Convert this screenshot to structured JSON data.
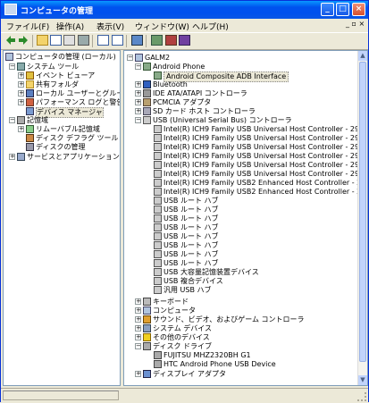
{
  "window": {
    "title": "コンピュータの管理"
  },
  "menu": [
    "ファイル(F)",
    "操作(A)",
    "表示(V)",
    "ウィンドウ(W)",
    "ヘルプ(H)"
  ],
  "left_tree": {
    "root": "コンピュータの管理 (ローカル)",
    "system_tools": "システム ツール",
    "event_viewer": "イベント ビューア",
    "shared_folders": "共有フォルダ",
    "local_users": "ローカル ユーザーとグループ",
    "performance": "パフォーマンス ログと警告",
    "device_manager": "デバイス マネージャ",
    "storage": "記憶域",
    "removable": "リムーバブル記憶域",
    "defrag": "ディスク デフラグ ツール",
    "disk_mgmt": "ディスクの管理",
    "services": "サービスとアプリケーション"
  },
  "right_tree": {
    "root": "GALM2",
    "android_phone": "Android Phone",
    "android_adb": "Android Composite ADB Interface",
    "bluetooth": "Bluetooth",
    "ide": "IDE ATA/ATAPI コントローラ",
    "pcmcia": "PCMCIA アダプタ",
    "sd": "SD カード ホスト コントローラ",
    "usb_controllers": "USB (Universal Serial Bus) コントローラ",
    "usb_items": [
      "Intel(R) ICH9 Family USB Universal Host Controller - 2934",
      "Intel(R) ICH9 Family USB Universal Host Controller - 2935",
      "Intel(R) ICH9 Family USB Universal Host Controller - 2936",
      "Intel(R) ICH9 Family USB Universal Host Controller - 2937",
      "Intel(R) ICH9 Family USB Universal Host Controller - 2938",
      "Intel(R) ICH9 Family USB Universal Host Controller - 2939",
      "Intel(R) ICH9 Family USB2 Enhanced Host Controller - 293A",
      "Intel(R) ICH9 Family USB2 Enhanced Host Controller - 293C",
      "USB ルート ハブ",
      "USB ルート ハブ",
      "USB ルート ハブ",
      "USB ルート ハブ",
      "USB ルート ハブ",
      "USB ルート ハブ",
      "USB ルート ハブ",
      "USB ルート ハブ",
      "USB 大容量記憶装置デバイス",
      "USB 複合デバイス",
      "汎用 USB ハブ"
    ],
    "keyboard": "キーボード",
    "computer": "コンピュータ",
    "sound": "サウンド、ビデオ、およびゲーム コントローラ",
    "system_devices": "システム デバイス",
    "other_devices": "その他のデバイス",
    "disk_drives": "ディスク ドライブ",
    "disk_items": [
      "FUJITSU MHZ2320BH G1",
      "HTC Android Phone USB Device"
    ],
    "display": "ディスプレイ アダプタ"
  }
}
